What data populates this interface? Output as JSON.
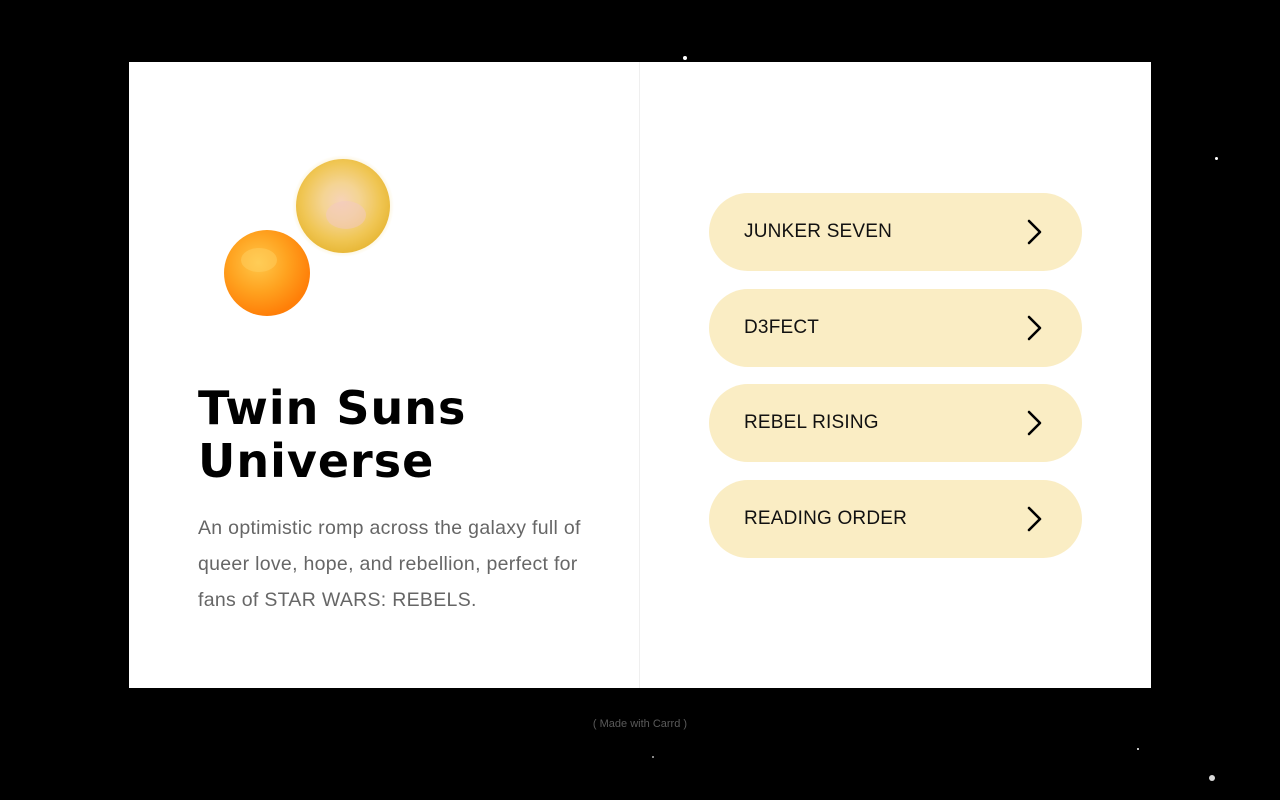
{
  "site": {
    "title": "Twin Suns Universe",
    "description": "An optimistic romp across the galaxy full of queer love, hope, and rebellion, perfect for fans of STAR WARS: REBELS."
  },
  "nav": {
    "items": [
      {
        "label": "JUNKER SEVEN",
        "icon": "chevron-right-icon"
      },
      {
        "label": "D3FECT",
        "icon": "chevron-right-icon"
      },
      {
        "label": "REBEL RISING",
        "icon": "chevron-right-icon"
      },
      {
        "label": "READING ORDER",
        "icon": "chevron-right-icon"
      }
    ]
  },
  "footer": {
    "credit": "( Made with Carrd )"
  },
  "colors": {
    "background": "#000000",
    "card": "#ffffff",
    "button": "#faedc4",
    "title": "#000000",
    "body_text": "#666666",
    "sun_large": "#f7c948",
    "sun_small": "#ff9a1a"
  },
  "images": {
    "logo": "twin-suns-illustration"
  }
}
